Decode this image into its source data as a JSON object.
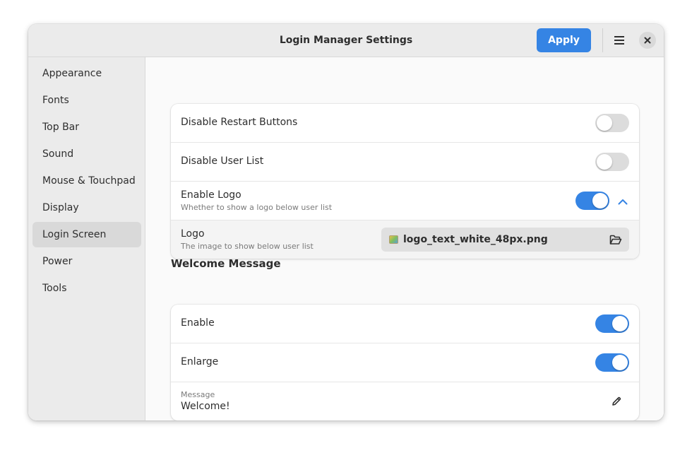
{
  "window": {
    "title": "Login Manager Settings",
    "apply_label": "Apply",
    "menu_icon": "hamburger-menu-icon",
    "close_icon": "close-icon"
  },
  "sidebar": {
    "items": [
      {
        "label": "Appearance",
        "selected": false
      },
      {
        "label": "Fonts",
        "selected": false
      },
      {
        "label": "Top Bar",
        "selected": false
      },
      {
        "label": "Sound",
        "selected": false
      },
      {
        "label": "Mouse & Touchpad",
        "selected": false
      },
      {
        "label": "Display",
        "selected": false
      },
      {
        "label": "Login Screen",
        "selected": true
      },
      {
        "label": "Power",
        "selected": false
      },
      {
        "label": "Tools",
        "selected": false
      }
    ]
  },
  "login": {
    "disable_restart": {
      "label": "Disable Restart Buttons",
      "enabled": false
    },
    "disable_user_list": {
      "label": "Disable User List",
      "enabled": false
    },
    "enable_logo": {
      "label": "Enable Logo",
      "subtitle": "Whether to show a logo below user list",
      "enabled": true,
      "expanded": true
    },
    "logo": {
      "label": "Logo",
      "subtitle": "The image to show below user list",
      "file": "logo_text_white_48px.png",
      "file_icon": "image-file-icon",
      "open_icon": "folder-open-icon"
    }
  },
  "welcome": {
    "section_title": "Welcome Message",
    "enable": {
      "label": "Enable",
      "enabled": true
    },
    "enlarge": {
      "label": "Enlarge",
      "enabled": true
    },
    "message": {
      "label": "Message",
      "value": "Welcome!",
      "edit_icon": "pencil-icon"
    }
  },
  "colors": {
    "accent": "#3584e4",
    "window_bg": "#fafafa",
    "sidebar_bg": "#ebebeb"
  }
}
